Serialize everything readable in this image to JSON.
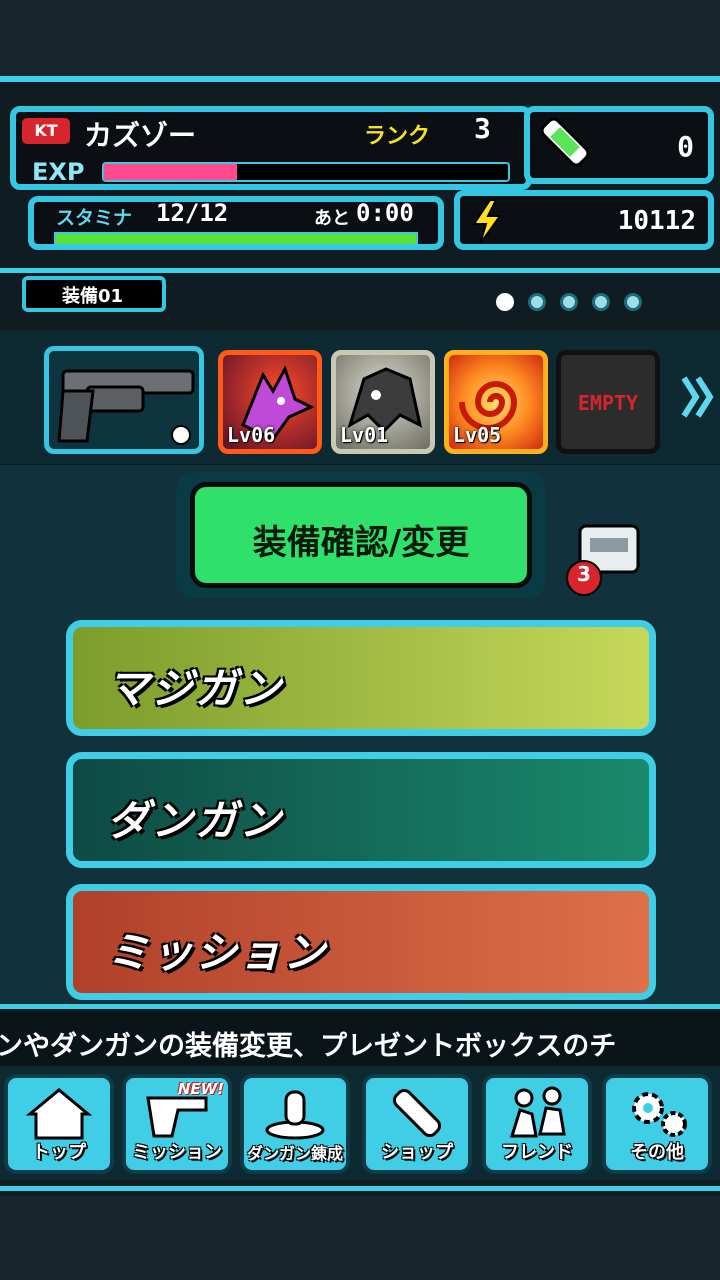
{
  "header": {
    "badge": "KT",
    "player_name": "カズゾー",
    "rank_label": "ランク",
    "rank_value": "3",
    "exp_label": "EXP",
    "exp_progress": 0.33,
    "gem_count": "0",
    "stamina_label": "スタミナ",
    "stamina_value": "12/12",
    "recover_label": "あと",
    "recover_time": "0:00",
    "coins": "10112",
    "stamina_progress": 1.0
  },
  "equipment": {
    "set_label": "装備01",
    "page_count": 5,
    "active_page": 0,
    "slots": [
      {
        "level": "Lv06"
      },
      {
        "level": "Lv01"
      },
      {
        "level": "Lv05"
      },
      {
        "empty_label": "EMPTY"
      }
    ]
  },
  "main": {
    "confirm_button": "装備確認/変更",
    "present_count": "3",
    "menu": [
      {
        "label": "マジガン"
      },
      {
        "label": "ダンガン"
      },
      {
        "label": "ミッション"
      }
    ]
  },
  "ticker": "ンやダンガンの装備変更、プレゼントボックスのチ",
  "nav": {
    "new_badge": "NEW!",
    "items": [
      {
        "label": "トップ",
        "icon": "house-icon"
      },
      {
        "label": "ミッション",
        "icon": "revolver-icon"
      },
      {
        "label": "ダンガン錬成",
        "icon": "bullet-forge-icon"
      },
      {
        "label": "ショップ",
        "icon": "capsule-icon"
      },
      {
        "label": "フレンド",
        "icon": "friends-icon"
      },
      {
        "label": "その他",
        "icon": "gear-icon"
      }
    ]
  },
  "colors": {
    "accent": "#35c6e2",
    "exp_bar": "#ff4a8e",
    "stamina_bar": "#59e23a",
    "rank_text": "#f5e51e",
    "confirm_green": "#2fe06a"
  }
}
